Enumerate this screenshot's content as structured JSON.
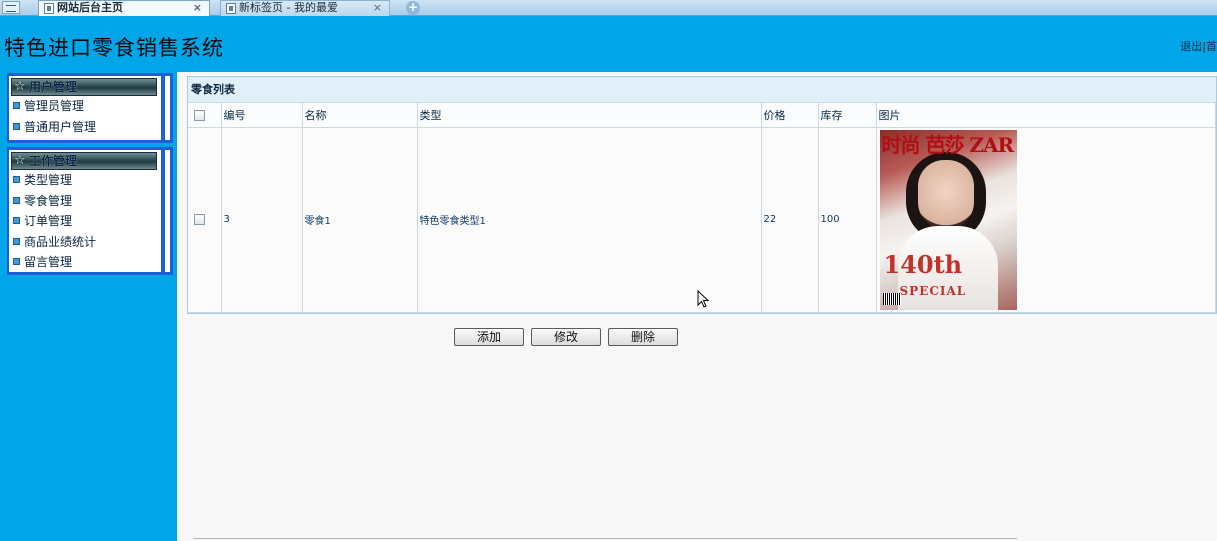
{
  "browser": {
    "tabs": [
      {
        "label": "网站后台主页",
        "active": true
      },
      {
        "label": "新标签页 - 我的最爱",
        "active": false
      }
    ],
    "close_glyph": "×",
    "new_tab_glyph": "+"
  },
  "header": {
    "title": "特色进口零食销售系统",
    "links": "退出|首"
  },
  "sidebar": {
    "groups": [
      {
        "title": "用户管理",
        "items": [
          "管理员管理",
          "普通用户管理"
        ]
      },
      {
        "title": "工作管理",
        "items": [
          "类型管理",
          "零食管理",
          "订单管理",
          "商品业绩统计",
          "留言管理"
        ]
      }
    ]
  },
  "list": {
    "title": "零食列表",
    "columns": [
      "编号",
      "名称",
      "类型",
      "价格",
      "库存",
      "图片"
    ],
    "rows": [
      {
        "id": "3",
        "name": "零食1",
        "type": "特色零食类型1",
        "price": "22",
        "stock": "100"
      }
    ],
    "image_text": {
      "masthead": "时尚 芭莎 ZAR",
      "big": "140th",
      "special": "SPECIAL"
    }
  },
  "buttons": {
    "add": "添加",
    "edit": "修改",
    "delete": "删除"
  },
  "colors": {
    "background": "#00a6e8",
    "menu_border": "#1e5fd8"
  }
}
